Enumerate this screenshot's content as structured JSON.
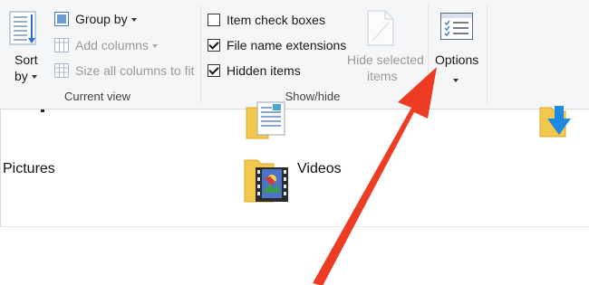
{
  "ribbon": {
    "current_view": {
      "sort_by_line1": "Sort",
      "sort_by_line2": "by",
      "group_by": "Group by",
      "add_columns": "Add columns",
      "size_columns": "Size all columns to fit",
      "label": "Current view"
    },
    "show_hide": {
      "item_check_boxes": {
        "label": "Item check boxes",
        "checked": false
      },
      "file_name_extensions": {
        "label": "File name extensions",
        "checked": true
      },
      "hidden_items": {
        "label": "Hidden items",
        "checked": true
      },
      "hide_selected_line1": "Hide selected",
      "hide_selected_line2": "items",
      "label": "Show/hide"
    },
    "options_label": "Options"
  },
  "content": {
    "items": [
      {
        "name": "Pictures",
        "icon": "pictures-folder-icon"
      },
      {
        "name": "Videos",
        "icon": "videos-folder-icon"
      }
    ]
  },
  "annotation": {
    "arrow_color": "#ee3b24"
  },
  "colors": {
    "folder": "#f2c94c",
    "download_arrow": "#1e88e5",
    "ribbon_bg": "#f5f6f7"
  }
}
